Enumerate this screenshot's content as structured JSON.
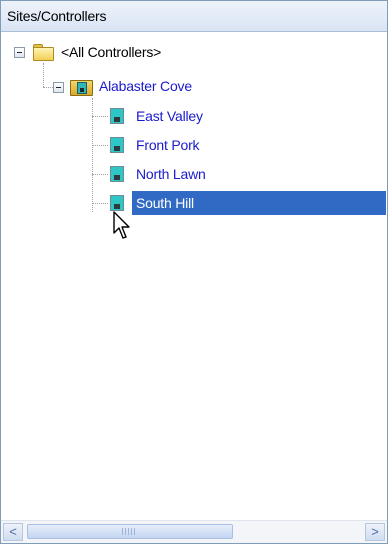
{
  "panel": {
    "title": "Sites/Controllers"
  },
  "tree": {
    "root": {
      "label": "<All Controllers>",
      "icon": "folder-icon",
      "expanded": true
    },
    "site": {
      "label": "Alabaster Cove",
      "icon": "site-folder-icon",
      "expanded": true
    },
    "controllers": [
      {
        "label": "East Valley",
        "icon": "controller-icon",
        "selected": false
      },
      {
        "label": "Front Pork",
        "icon": "controller-icon",
        "selected": false
      },
      {
        "label": "North Lawn",
        "icon": "controller-icon",
        "selected": false
      },
      {
        "label": "South Hill",
        "icon": "controller-icon",
        "selected": true
      }
    ]
  },
  "scrollbar": {
    "left_arrow": "<",
    "right_arrow": ">"
  },
  "colors": {
    "selection": "#316ac5",
    "node_text": "#1a1acc",
    "border": "#7f9db9"
  }
}
